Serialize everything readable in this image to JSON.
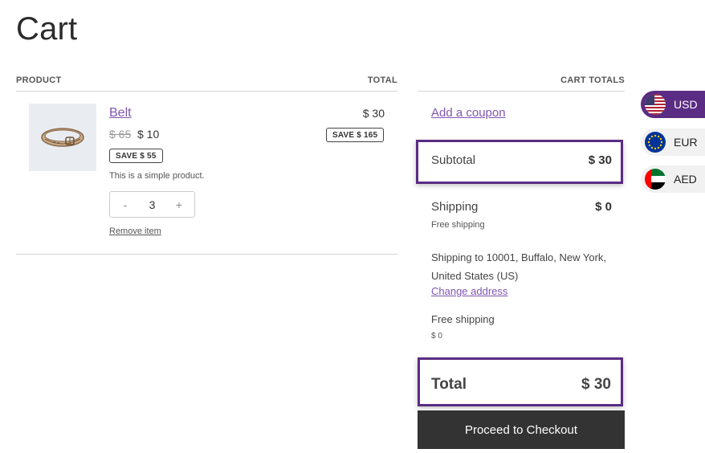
{
  "page": {
    "title": "Cart"
  },
  "table_headers": {
    "product": "PRODUCT",
    "total": "TOTAL",
    "cart_totals": "CART TOTALS"
  },
  "item": {
    "name": "Belt",
    "regular_price": "$ 65",
    "sale_price": "$ 10",
    "item_save_badge": "SAVE $ 55",
    "description": "This is a simple product.",
    "quantity_minus": "-",
    "quantity": "3",
    "quantity_plus": "+",
    "remove_label": "Remove item",
    "line_total": "$ 30",
    "line_save_badge": "SAVE $ 165",
    "image_icon": "belt-image"
  },
  "totals": {
    "coupon_link": "Add a coupon",
    "subtotal_label": "Subtotal",
    "subtotal_value": "$ 30",
    "shipping_label": "Shipping",
    "shipping_value": "$ 0",
    "shipping_method": "Free shipping",
    "shipping_to_line1": "Shipping to 10001, Buffalo, New York,",
    "shipping_to_line2": "United States (US)",
    "change_address": "Change address",
    "option_label": "Free shipping",
    "option_price": "$ 0",
    "total_label": "Total",
    "total_value": "$ 30",
    "checkout_button": "Proceed to Checkout"
  },
  "currency_switcher": [
    {
      "code": "USD",
      "icon": "us-flag-icon",
      "active": true
    },
    {
      "code": "EUR",
      "icon": "eu-flag-icon",
      "active": false
    },
    {
      "code": "AED",
      "icon": "uae-flag-icon",
      "active": false
    }
  ],
  "colors": {
    "accent": "#7f54b3",
    "highlight_border": "#5b2c83",
    "checkout_bg": "#333333"
  }
}
